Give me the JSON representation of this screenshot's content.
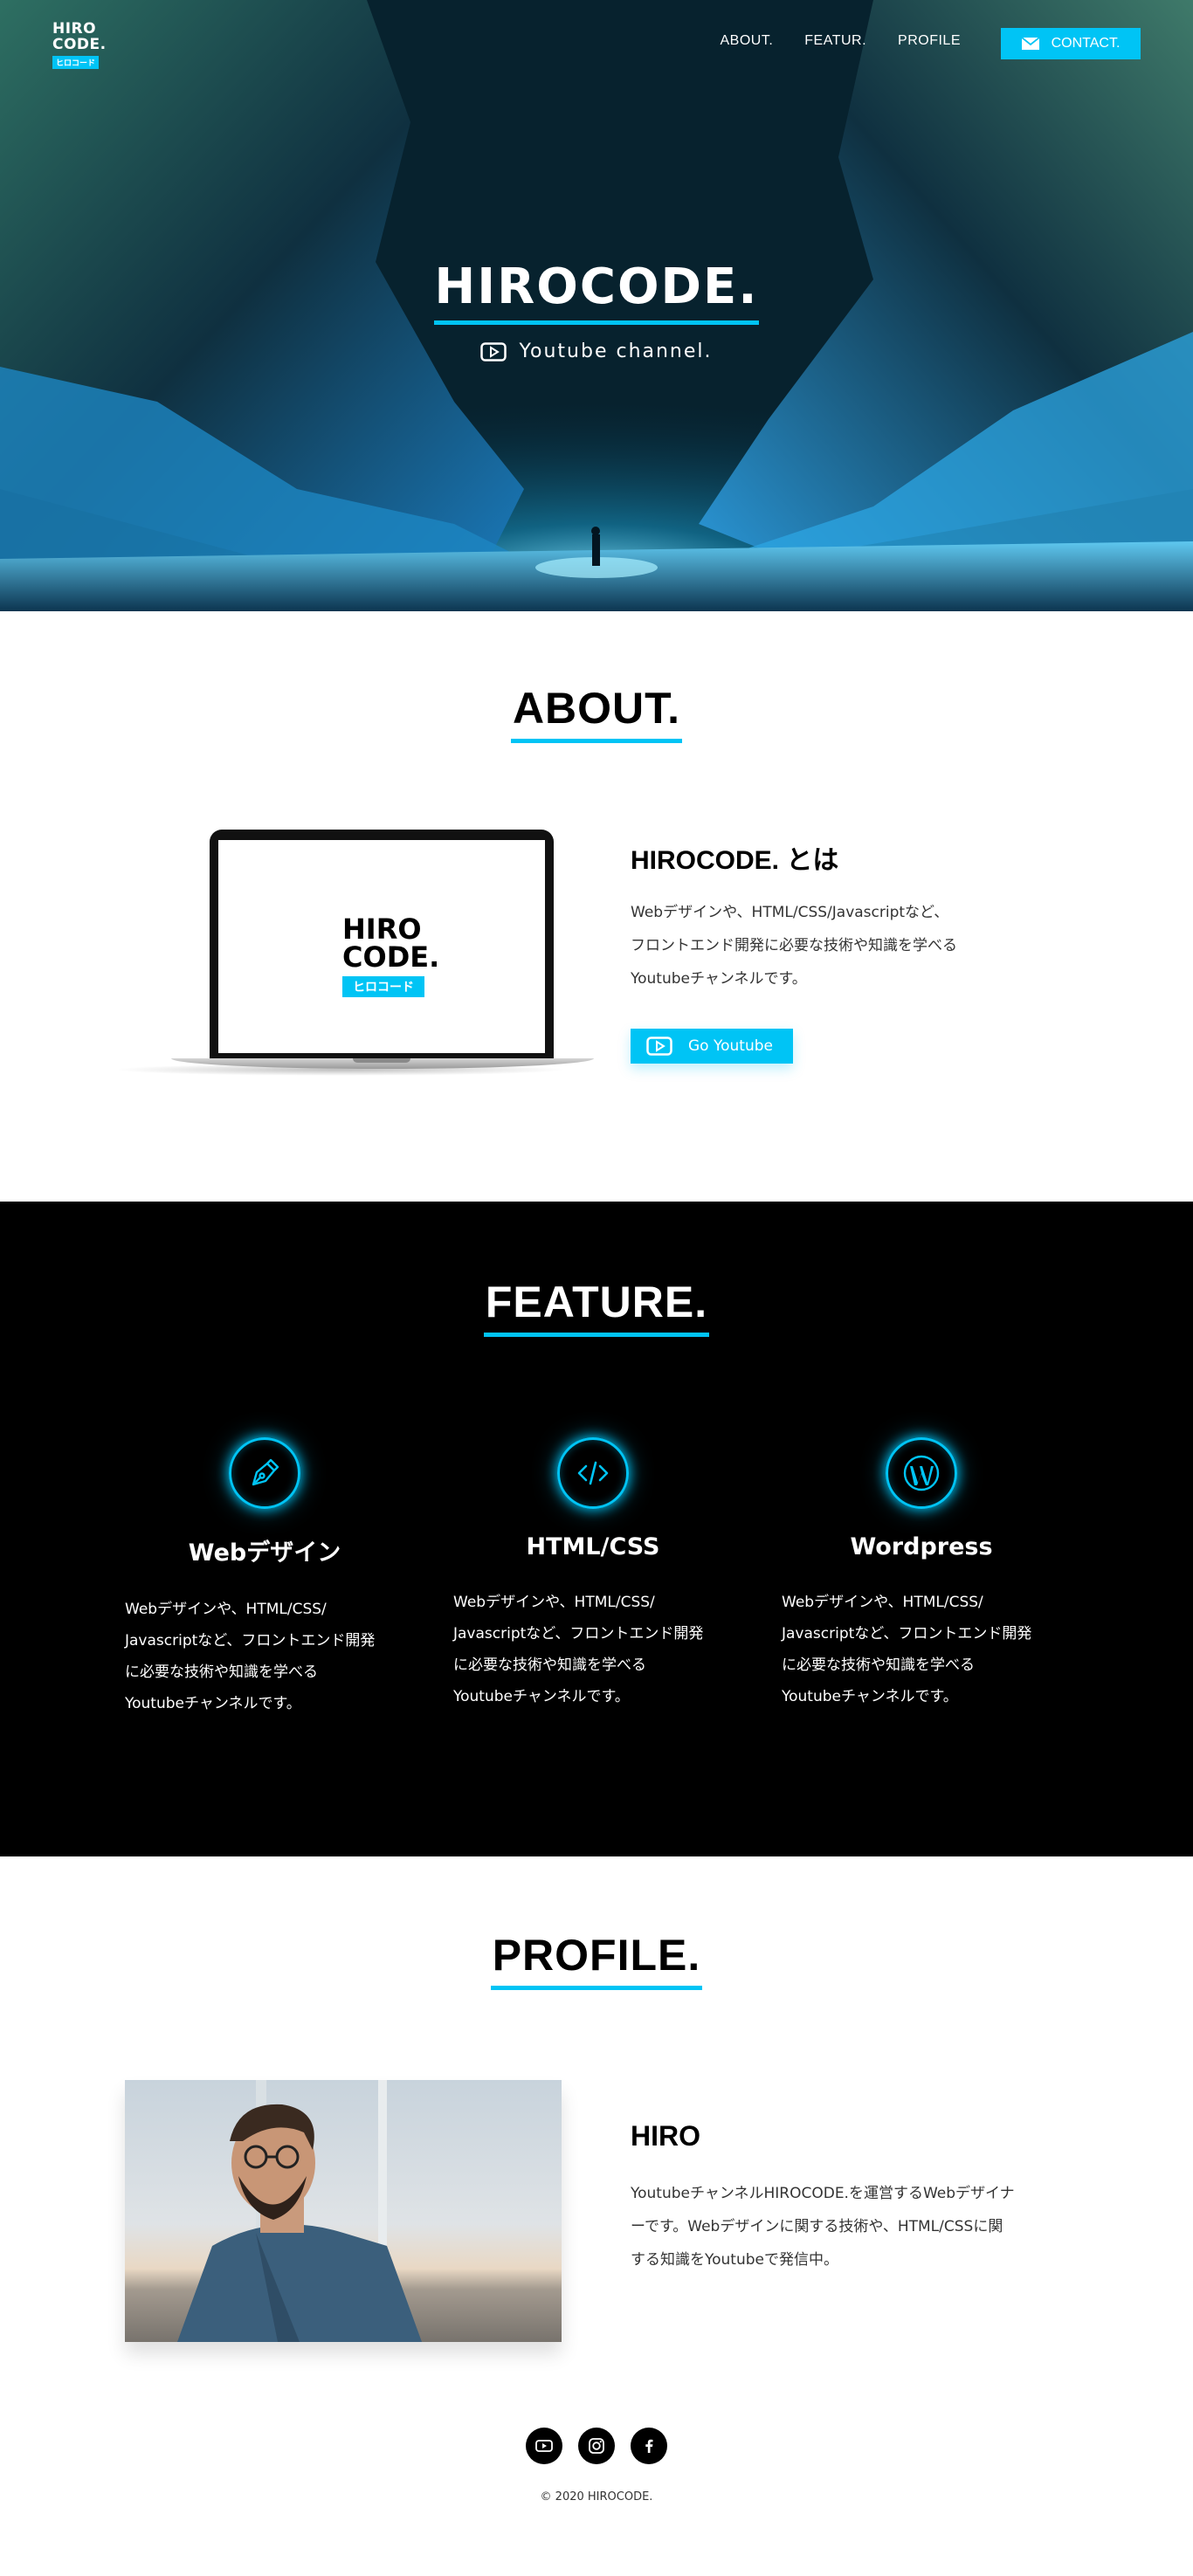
{
  "header": {
    "logo": {
      "line1": "HIRO",
      "line2": "CODE.",
      "tag": "ヒロコード"
    },
    "nav": [
      "ABOUT.",
      "FEATUR.",
      "PROFILE"
    ],
    "contact_label": "CONTACT."
  },
  "hero": {
    "title": "HIROCODE.",
    "subtitle": "Youtube channel."
  },
  "about": {
    "section_title": "ABOUT.",
    "screen_logo": {
      "line1": "HIRO",
      "line2": "CODE.",
      "tag": "ヒロコード"
    },
    "heading": "HIROCODE. とは",
    "body": [
      "Webデザインや、HTML/CSS/Javascriptなど、",
      "フロントエンド開発に必要な技術や知識を学べる",
      "Youtubeチャンネルです。"
    ],
    "button_label": "Go Youtube"
  },
  "feature": {
    "section_title": "FEATURE.",
    "items": [
      {
        "icon": "pen-nib-icon",
        "title": "Webデザイン",
        "body": [
          "Webデザインや、HTML/CSS/",
          "Javascriptなど、フロントエンド開発",
          "に必要な技術や知識を学べる",
          "Youtubeチャンネルです。"
        ]
      },
      {
        "icon": "code-icon",
        "title": "HTML/CSS",
        "body": [
          "Webデザインや、HTML/CSS/",
          "Javascriptなど、フロントエンド開発",
          "に必要な技術や知識を学べる",
          "Youtubeチャンネルです。"
        ]
      },
      {
        "icon": "wordpress-icon",
        "title": "Wordpress",
        "body": [
          "Webデザインや、HTML/CSS/",
          "Javascriptなど、フロントエンド開発",
          "に必要な技術や知識を学べる",
          "Youtubeチャンネルです。"
        ]
      }
    ]
  },
  "profile": {
    "section_title": "PROFILE.",
    "name": "HIRO",
    "body": [
      "YoutubeチャンネルHIROCODE.を運営するWebデザイナ",
      "ーです。Webデザインに関する技術や、HTML/CSSに関",
      "する知識をYoutubeで発信中。"
    ]
  },
  "footer": {
    "socials": [
      "youtube-icon",
      "instagram-icon",
      "facebook-icon"
    ],
    "copyright": "© 2020 HIROCODE."
  },
  "colors": {
    "accent": "#00c4f5",
    "dark": "#000000",
    "text": "#333333"
  }
}
